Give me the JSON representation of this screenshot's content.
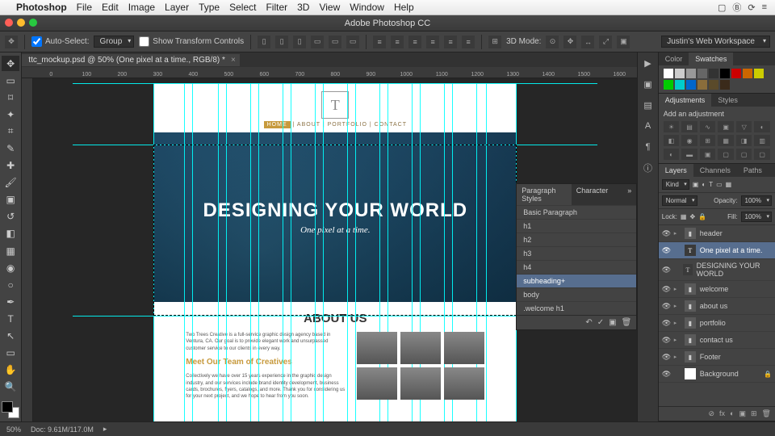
{
  "mac_menu": {
    "app": "Photoshop",
    "items": [
      "File",
      "Edit",
      "Image",
      "Layer",
      "Type",
      "Select",
      "Filter",
      "3D",
      "View",
      "Window",
      "Help"
    ]
  },
  "window_title": "Adobe Photoshop CC",
  "options": {
    "auto_select": "Auto-Select:",
    "auto_select_value": "Group",
    "show_transform": "Show Transform Controls",
    "mode_3d": "3D Mode:",
    "workspace": "Justin's Web Workspace"
  },
  "doc_tab": "ttc_mockup.psd @ 50% (One pixel at a time., RGB/8) *",
  "ruler_ticks": [
    "0",
    "100",
    "200",
    "300",
    "400",
    "500",
    "600",
    "700",
    "800",
    "900",
    "1000",
    "1100",
    "1200",
    "1300",
    "1400",
    "1500",
    "1600"
  ],
  "mockup": {
    "nav_home": "HOME",
    "nav_rest": "  |  ABOUT  |  PORTFOLIO  |  CONTACT",
    "hero_title": "DESIGNING YOUR WORLD",
    "hero_sub": "One pixel at a time.",
    "about_title": "ABOUT US",
    "about_p1": "Two Trees Creative is a full-service graphic design agency based in Ventura, CA. Our goal is to provide elegant work and unsurpassed customer service to our clients in every way.",
    "team_title": "Meet Our Team of Creatives",
    "about_p2": "Collectively we have over 15 years experience in the graphic design industry, and our services include brand identity development, business cards, brochures, flyers, catalogs, and more. Thank you for considering us for your next project, and we hope to hear from you soon."
  },
  "para_styles": {
    "tab1": "Paragraph Styles",
    "tab2": "Character",
    "items": [
      "Basic Paragraph",
      "h1",
      "h2",
      "h3",
      "h4",
      "subheading+",
      "body",
      ".welcome h1"
    ]
  },
  "color_tabs": {
    "t1": "Color",
    "t2": "Swatches"
  },
  "adjust": {
    "t1": "Adjustments",
    "t2": "Styles",
    "label": "Add an adjustment"
  },
  "layers": {
    "t1": "Layers",
    "t2": "Channels",
    "t3": "Paths",
    "kind": "Kind",
    "blend": "Normal",
    "opacity_l": "Opacity:",
    "opacity_v": "100%",
    "lock_l": "Lock:",
    "fill_l": "Fill:",
    "fill_v": "100%",
    "items": [
      {
        "name": "header",
        "type": "folder"
      },
      {
        "name": "One pixel at a time.",
        "type": "t",
        "sel": true
      },
      {
        "name": "DESIGNING YOUR WORLD",
        "type": "t"
      },
      {
        "name": "welcome",
        "type": "folder"
      },
      {
        "name": "about us",
        "type": "folder"
      },
      {
        "name": "portfolio",
        "type": "folder"
      },
      {
        "name": "contact us",
        "type": "folder"
      },
      {
        "name": "Footer",
        "type": "folder"
      },
      {
        "name": "Background",
        "type": "bg",
        "lock": true
      }
    ]
  },
  "status": {
    "zoom": "50%",
    "doc": "Doc: 9.61M/117.0M"
  }
}
